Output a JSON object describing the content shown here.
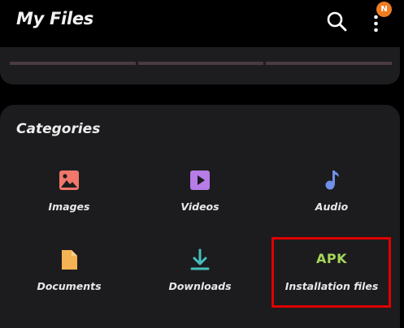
{
  "header": {
    "title": "My Files",
    "search_icon": "search-icon",
    "menu_icon": "more-vertical-icon",
    "badge_text": "N"
  },
  "categories": {
    "title": "Categories",
    "items": [
      {
        "label": "Images",
        "icon": "image-icon",
        "color": "#f0776a"
      },
      {
        "label": "Videos",
        "icon": "video-icon",
        "color": "#b77ce6"
      },
      {
        "label": "Audio",
        "icon": "music-note-icon",
        "color": "#6f8fe8"
      },
      {
        "label": "Documents",
        "icon": "document-icon",
        "color": "#f3b254"
      },
      {
        "label": "Downloads",
        "icon": "download-icon",
        "color": "#45c0bd"
      },
      {
        "label": "Installation files",
        "icon": "apk-icon",
        "icon_text": "APK",
        "color": "#a6d65c"
      }
    ]
  },
  "colors": {
    "background": "#000000",
    "card": "#1c1c1e",
    "badge": "#ef7b22",
    "highlight": "#e10000"
  }
}
